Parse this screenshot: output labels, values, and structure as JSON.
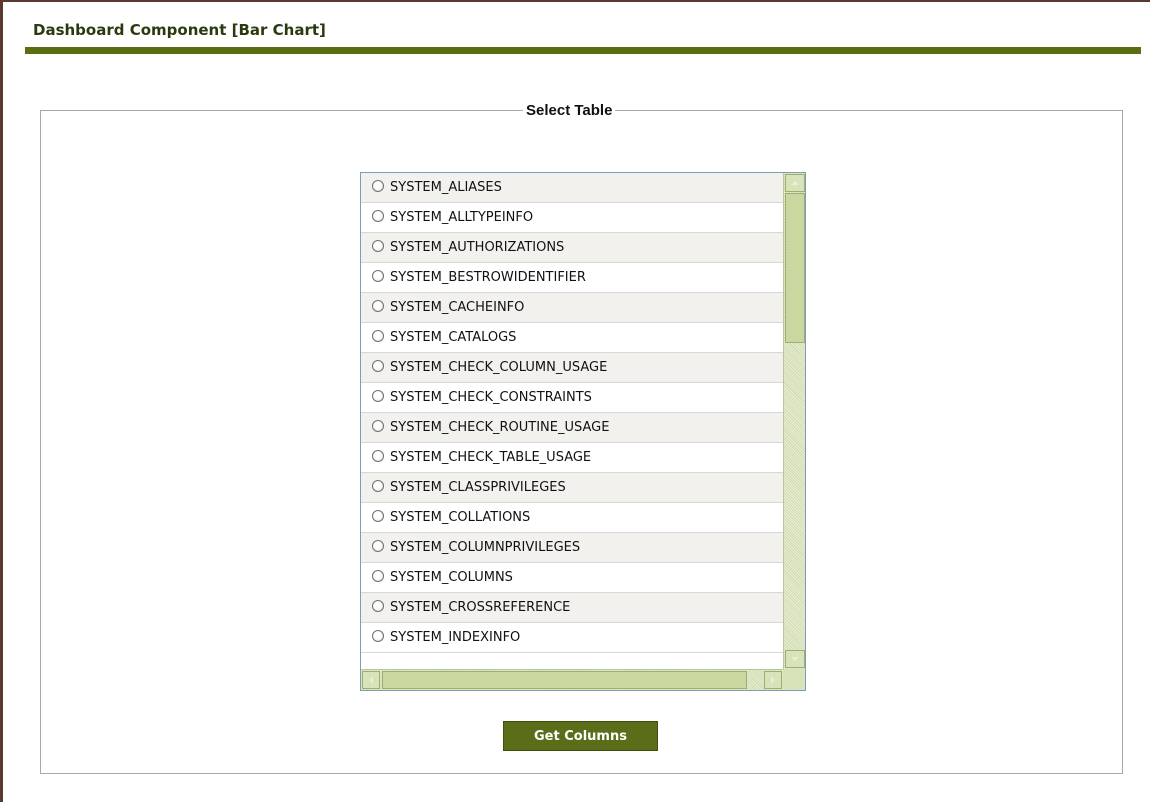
{
  "page": {
    "title": "Dashboard Component [Bar Chart]"
  },
  "select_table": {
    "legend": "Select Table",
    "tables": [
      "SYSTEM_ALIASES",
      "SYSTEM_ALLTYPEINFO",
      "SYSTEM_AUTHORIZATIONS",
      "SYSTEM_BESTROWIDENTIFIER",
      "SYSTEM_CACHEINFO",
      "SYSTEM_CATALOGS",
      "SYSTEM_CHECK_COLUMN_USAGE",
      "SYSTEM_CHECK_CONSTRAINTS",
      "SYSTEM_CHECK_ROUTINE_USAGE",
      "SYSTEM_CHECK_TABLE_USAGE",
      "SYSTEM_CLASSPRIVILEGES",
      "SYSTEM_COLLATIONS",
      "SYSTEM_COLUMNPRIVILEGES",
      "SYSTEM_COLUMNS",
      "SYSTEM_CROSSREFERENCE",
      "SYSTEM_INDEXINFO"
    ]
  },
  "actions": {
    "get_columns_label": "Get Columns"
  },
  "colors": {
    "accent": "#5a6d13",
    "button_bg": "#5a6e1a",
    "title_text": "#2b3a0e",
    "scrollbar": "#c9d89e"
  }
}
